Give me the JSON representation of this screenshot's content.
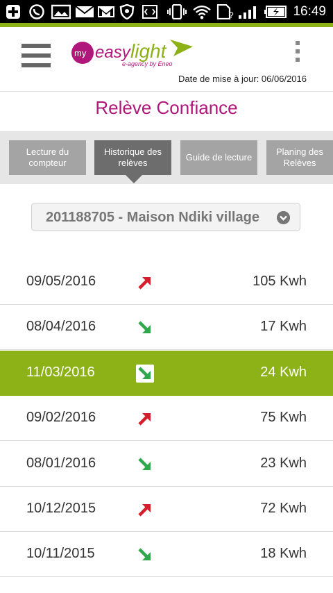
{
  "status_bar": {
    "time": "16:49",
    "icons": [
      "plus-icon",
      "whatsapp-icon",
      "image-icon",
      "mail-icon",
      "gmail-icon",
      "shield-icon",
      "code-icon",
      "vibrate-icon",
      "wifi-icon",
      "sim-icon",
      "signal-icon",
      "battery-charging-icon"
    ]
  },
  "header": {
    "logo_alt": "myeasylight e-agency by Eneo",
    "update_date": "Date de mise à jour: 06/06/2016"
  },
  "page": {
    "title": "Relève Confiance"
  },
  "tabs": [
    {
      "label": "Lecture du compteur",
      "active": false
    },
    {
      "label": "Historique des relèves",
      "active": true
    },
    {
      "label": "Guide de lecture",
      "active": false
    },
    {
      "label": "Planing des Relèves",
      "active": false
    }
  ],
  "meter_select": {
    "value": "201188705 - Maison Ndiki village"
  },
  "readings": [
    {
      "date": "09/05/2016",
      "trend": "up",
      "kwh": "105 Kwh",
      "highlight": false
    },
    {
      "date": "08/04/2016",
      "trend": "down",
      "kwh": "17 Kwh",
      "highlight": false
    },
    {
      "date": "11/03/2016",
      "trend": "down",
      "kwh": "24 Kwh",
      "highlight": true
    },
    {
      "date": "09/02/2016",
      "trend": "up",
      "kwh": "75 Kwh",
      "highlight": false
    },
    {
      "date": "08/01/2016",
      "trend": "down",
      "kwh": "23 Kwh",
      "highlight": false
    },
    {
      "date": "10/12/2015",
      "trend": "up",
      "kwh": "72 Kwh",
      "highlight": false
    },
    {
      "date": "10/11/2015",
      "trend": "down",
      "kwh": "18 Kwh",
      "highlight": false
    }
  ],
  "colors": {
    "accent_green": "#8cb217",
    "title_magenta": "#b0177a",
    "trend_up": "#d21f2b",
    "trend_down": "#2ea84a"
  }
}
